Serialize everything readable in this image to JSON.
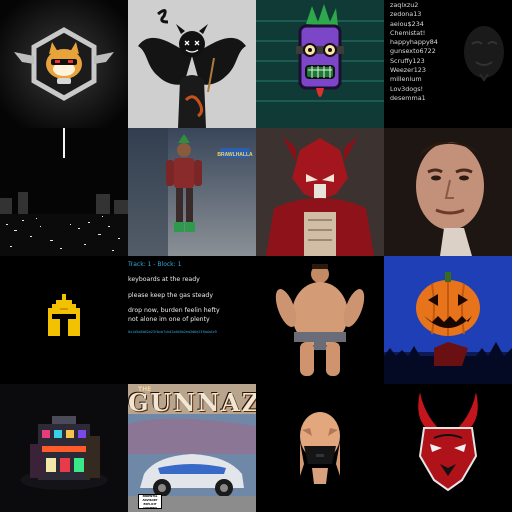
{
  "gallery": {
    "usernames": [
      "zaqlxzu2",
      "zedona13",
      "aeiou$234",
      "Chemistat!",
      "happyhappy84",
      "gunsexto6722",
      "Scruffy123",
      "Weezer123",
      "millenium",
      "Lov3dogs!",
      "desemma1"
    ],
    "lyrics": {
      "track_label": "Track: 1 - Block: 1",
      "lines": [
        "keyboards at the ready",
        "please keep the gas steady",
        "drop now, burden feelin hefty",
        "not alone im one of plenty"
      ],
      "hash": "0x1d5a5b62a23fbcb7cb42a4b9a2ea3d6e23fbda4c9"
    },
    "album": {
      "the": "THE",
      "title": "GUNNAZ",
      "advisory": [
        "PARENTAL",
        "ADVISORY",
        "EXPLICIT CONTENT"
      ]
    },
    "game_logo_text": "BRAWLHALLA"
  },
  "colors": {
    "background": "#000000",
    "lyrics_accent": "#31a9d8",
    "pumpkin": "#e7741b",
    "helmet_yellow": "#f2c200"
  }
}
